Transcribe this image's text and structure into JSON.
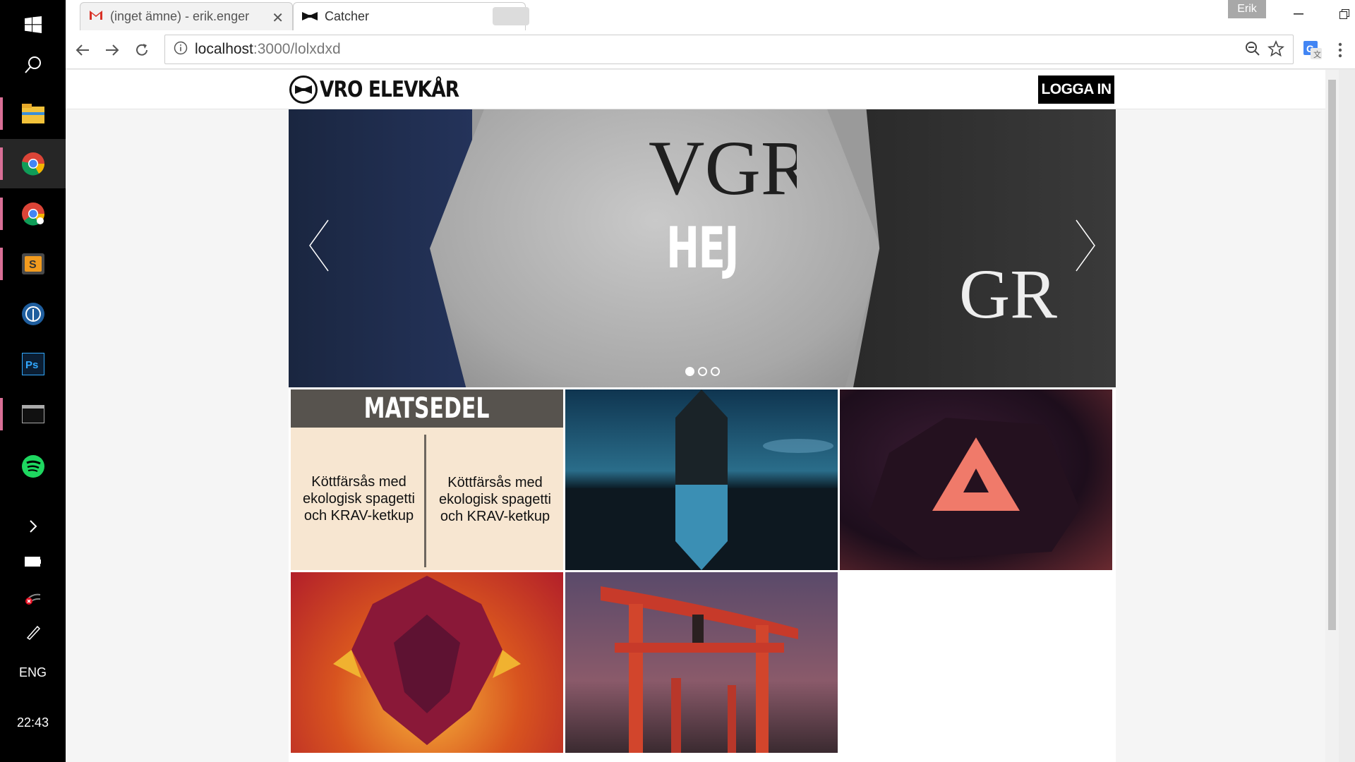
{
  "taskbar": {
    "items": [
      "start-icon",
      "search-icon",
      "file-explorer-icon",
      "chrome-icon",
      "chrome-canary-icon",
      "sublime-text-icon",
      "sourcetree-icon",
      "photoshop-icon",
      "terminal-icon",
      "spotify-icon"
    ],
    "language": "ENG",
    "time": "22:43"
  },
  "browser": {
    "tabs": [
      {
        "title": "(inget ämne) - erik.enger"
      },
      {
        "title": "Catcher"
      }
    ],
    "profile": "Erik",
    "url_host": "localhost",
    "url_path": ":3000/lolxdxd"
  },
  "site": {
    "brand": "VRO ELEVKÅR",
    "login_label": "LOGGA IN",
    "carousel": {
      "title": "HEJ",
      "slides": 3,
      "active_slide": 1
    },
    "menu": {
      "title": "MATSEDEL",
      "items": [
        "Köttfärsås med ekologisk spagetti och  KRAV-ketkup",
        "Köttfärsås med ekologisk spagetti och  KRAV-ketkup"
      ]
    }
  },
  "colors": {
    "brand_black": "#000000",
    "menu_header": "#57534e",
    "menu_bg": "#f7e6d1",
    "taskbar": "#000000",
    "pin_accent": "#d96f96"
  }
}
